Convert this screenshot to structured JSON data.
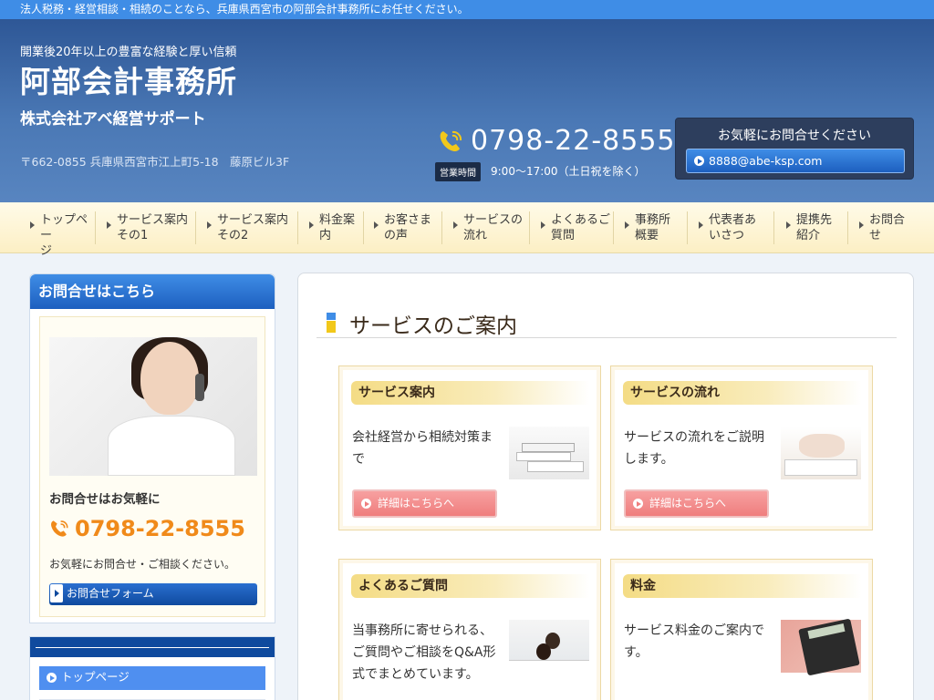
{
  "topbar": {
    "text": "法人税務・経営相談・相続のことなら、兵庫県西宮市の阿部会計事務所にお任せください。"
  },
  "header": {
    "tagline": "開業後20年以上の豊富な経験と厚い信頼",
    "title": "阿部会計事務所",
    "company": "株式会社アベ経営サポート",
    "address": "〒662-0855 兵庫県西宮市江上町5-18　藤原ビル3F",
    "phone": "0798-22-8555",
    "hours_badge": "営業時間",
    "hours": "9:00〜17:00（土日祝を除く）",
    "contact_title": "お気軽にお問合せください",
    "email": "8888@abe-ksp.com"
  },
  "nav": {
    "items": [
      {
        "label": "トップペー\nジ"
      },
      {
        "label": "サービス案内\nその1"
      },
      {
        "label": "サービス案内\nその2"
      },
      {
        "label": "料金案\n内"
      },
      {
        "label": "お客さま\nの声"
      },
      {
        "label": "サービスの\n流れ"
      },
      {
        "label": "よくあるご\n質問"
      },
      {
        "label": "事務所\n概要"
      },
      {
        "label": "代表者あ\nいさつ"
      },
      {
        "label": "提携先\n紹介"
      },
      {
        "label": "お問合\nせ"
      }
    ]
  },
  "sidebar": {
    "header": "お問合せはこちら",
    "label": "お問合せはお気軽に",
    "phone": "0798-22-8555",
    "note": "お気軽にお問合せ・ご相談ください。",
    "form_button": "お問合せフォーム",
    "nav_first": "トップページ"
  },
  "main": {
    "title": "サービスのご案内",
    "cards": [
      {
        "heading": "サービス案内",
        "text": "会社経営から相続対策まで",
        "button": "詳細はこちらへ"
      },
      {
        "heading": "サービスの流れ",
        "text": "サービスの流れをご説明します。",
        "button": "詳細はこちらへ"
      },
      {
        "heading": "よくあるご質問",
        "text": "当事務所に寄せられる、ご質問やご相談をQ&A形式でまとめています。",
        "button": ""
      },
      {
        "heading": "料金",
        "text": "サービス料金のご案内です。",
        "button": ""
      }
    ]
  },
  "colors": {
    "topbar": "#3f8de6",
    "header": "#4a78b5",
    "nav_bg": "#fcefc4",
    "sidebar_header": "#1d5fbf",
    "phone_orange": "#f08a1a",
    "detail_button": "#ef7e7e",
    "card_heading": "#f4dc85"
  }
}
